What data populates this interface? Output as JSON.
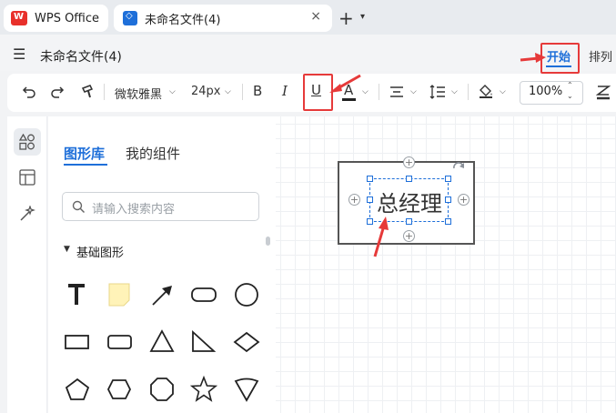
{
  "tabs": {
    "app_tab": "WPS Office",
    "doc_tab": "未命名文件(4)",
    "close": "×",
    "new": "+",
    "new_dropdown": "⌄"
  },
  "menubar": {
    "filename": "未命名文件(4)",
    "start": "开始",
    "arrange": "排列"
  },
  "toolbar": {
    "font_name": "微软雅黑",
    "font_size": "24px",
    "bold": "B",
    "italic": "I",
    "underline": "U",
    "font_color": "A",
    "zoom": "100%"
  },
  "panel": {
    "tab_library": "图形库",
    "tab_my_components": "我的组件",
    "search_placeholder": "请输入搜索内容",
    "section_title": "基础图形",
    "shapes_row1": [
      "text-tool",
      "note",
      "arrow",
      "rounded-rectangle",
      "circle"
    ],
    "shapes_row2": [
      "rectangle",
      "rounded-rectangle",
      "triangle",
      "right-triangle",
      "diamond"
    ],
    "shapes_row3": [
      "pentagon",
      "hexagon",
      "octagon",
      "star",
      "funnel"
    ]
  },
  "canvas": {
    "shape_text": "总经理"
  },
  "colors": {
    "accent": "#1e6fd9",
    "annotation": "#e63a3a"
  }
}
